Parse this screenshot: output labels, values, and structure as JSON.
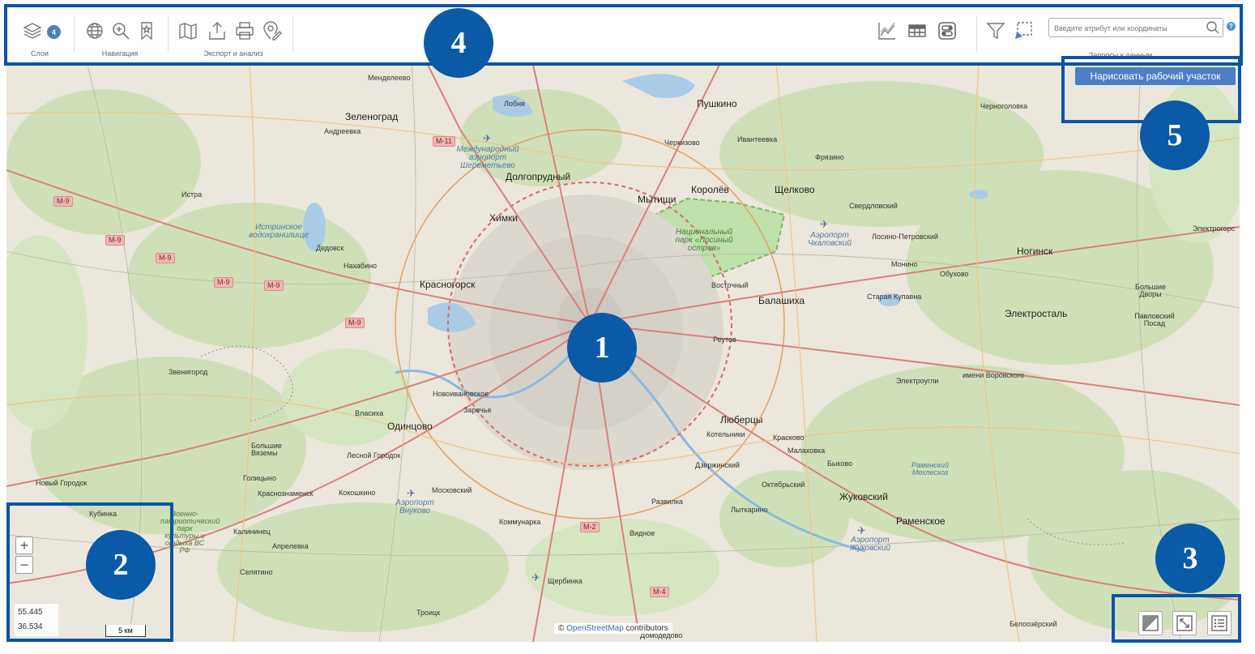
{
  "toolbar": {
    "layers_badge": "4",
    "groups": {
      "layers": "Слои",
      "navigation": "Навигация",
      "export": "Экспорт и анализ",
      "queries": "Запросы к данным"
    },
    "search": {
      "placeholder": "Введите атрибут или координаты"
    },
    "help": "?"
  },
  "draw_button": "Нарисовать рабочий участок",
  "map_controls": {
    "zoom_in": "+",
    "zoom_out": "−",
    "lat": "55.445",
    "lon": "36.534",
    "scale": "5 км"
  },
  "attribution": {
    "prefix": "©",
    "link": "OpenStreetMap",
    "suffix": "contributors"
  },
  "callouts": [
    "1",
    "2",
    "3",
    "4",
    "5"
  ],
  "map_places": {
    "mendeleevo": "Менделеево",
    "zelenograd": "Зеленоград",
    "andreevka": "Андреевка",
    "lobnya": "Лобня",
    "pushkino": "Пушкино",
    "chernogolovka": "Черноголовка",
    "cherkizovo": "Черкизово",
    "ivanteevka": "Ивантеевка",
    "fryazino": "Фрязино",
    "airport_sheremetyevo": "Международный аэропорт Шереметьево",
    "dolgoprudny": "Долгопрудный",
    "mytishchi": "Мытищи",
    "korolev": "Королёв",
    "shchelkovo": "Щелково",
    "sverdlovsky": "Свердловский",
    "istra": "Истра",
    "istra_reservoir": "Истринское водохранилище",
    "khimki": "Химки",
    "losiny_ostrov": "Национальный парк «Лосиный остров»",
    "airport_chkalovsky": "Аэропорт Чкаловский",
    "losino_petrovsky": "Лосино-Петровский",
    "noginsk": "Ногинск",
    "elektrogorsk": "Электрогорс",
    "dedovsk": "Дедовск",
    "nakhabino": "Нахабино",
    "monino": "Монино",
    "obukhovo": "Обухово",
    "krasnogorsk": "Красногорск",
    "vostochny": "Восточный",
    "balashikha": "Балашиха",
    "staraya_kupavna": "Старая Купавна",
    "bolshie_dvory": "Большие Дворы",
    "elektrostal": "Электросталь",
    "pavlovsky_posad": "Павловский Посад",
    "reutov": "Реутов",
    "zvenigorod": "Звенигород",
    "elektrougli": "Электроугли",
    "imeni_vorovskogo": "имени Воровского",
    "novoivanovskoe": "Новоивановское",
    "zarechye": "Заречье",
    "vlasikha": "Власиха",
    "odintsovo": "Одинцово",
    "lyubertsy": "Люберцы",
    "kotelniki": "Котельники",
    "kraskovo": "Красково",
    "bolshie_vyazemy": "Большие Вяземы",
    "lesnoy_gorodok": "Лесной Городок",
    "malakhovka": "Малаховка",
    "novy_gorodok": "Новый Городок",
    "golitsyno": "Голицыно",
    "dzerzhinsky": "Дзержинский",
    "bykovo": "Быково",
    "ramensky_mekhleskhoz": "Раменский Мехлесхоз",
    "krasnoznamensk": "Краснознаменск",
    "kokoshkino": "Кокошкино",
    "moskovsky": "Московский",
    "oktyabrsky": "Октябрьский",
    "zhukovsky": "Жуковский",
    "kubinka": "Кубинка",
    "military_park": "Военно-патриотический парк культуры и отдыха ВС РФ",
    "airport_vnukovo": "Аэропорт Внуково",
    "razvilka": "Развилка",
    "lytkarino": "Лыткарино",
    "kommunarka": "Коммунарка",
    "ramenskoe": "Раменское",
    "kalininets": "Калининец",
    "vidnoe": "Видное",
    "aprelevka": "Апрелевка",
    "airport_zhukovsky": "Аэропорт Жуковский",
    "selyatino": "Селятино",
    "shcherbinka": "Щербинка",
    "troitsk": "Троицк",
    "domodedovo": "Домодедово",
    "beloozersky": "Белоозёрский"
  },
  "road_shields": {
    "m11": "М-11",
    "m9": "М-9",
    "m2": "М-2",
    "m4": "М-4"
  },
  "colors": {
    "callout": "#0a55a6",
    "button": "#4c7fc6",
    "badge": "#4a7fc1"
  }
}
